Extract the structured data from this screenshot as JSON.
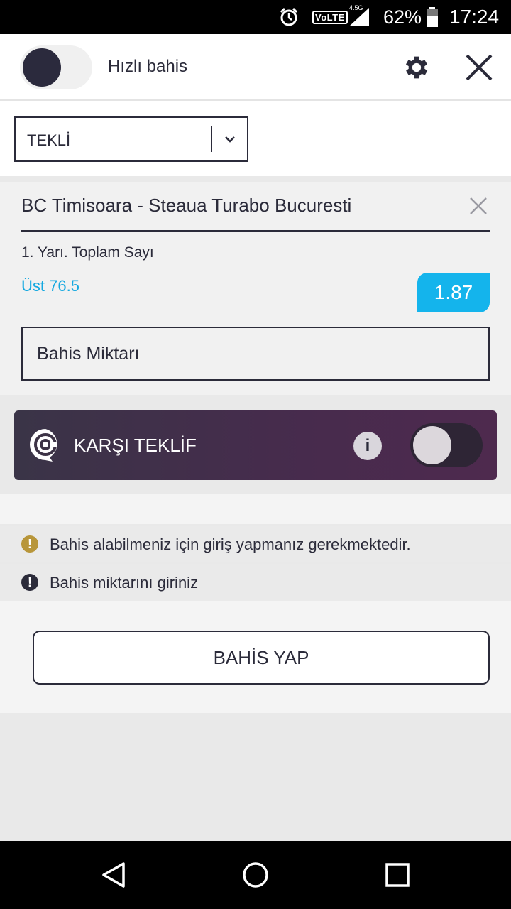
{
  "status_bar": {
    "network": "VoLTE",
    "network_type": "4.5G",
    "battery": "62%",
    "time": "17:24"
  },
  "header": {
    "quick_bet_label": "Hızlı bahis",
    "quick_bet_enabled": false
  },
  "bet_type": {
    "selected": "TEKLİ"
  },
  "slip": {
    "match": "BC Timisoara - Steaua Turabo Bucuresti",
    "market": "1. Yarı. Toplam Sayı",
    "selection": "Üst 76.5",
    "odds": "1.87",
    "stake_placeholder": "Bahis Miktarı"
  },
  "counter_offer": {
    "label": "KARŞI TEKLİF",
    "info": "i",
    "enabled": false
  },
  "messages": [
    {
      "icon": "!",
      "text": "Bahis alabilmeniz için giriş yapmanız gerekmektedir."
    },
    {
      "icon": "!",
      "text": "Bahis miktarını giriniz"
    }
  ],
  "place_bet": {
    "label": "BAHİS YAP"
  },
  "colors": {
    "accent": "#14b4ec",
    "dark": "#2b2b3a",
    "warning": "#b8963a"
  }
}
